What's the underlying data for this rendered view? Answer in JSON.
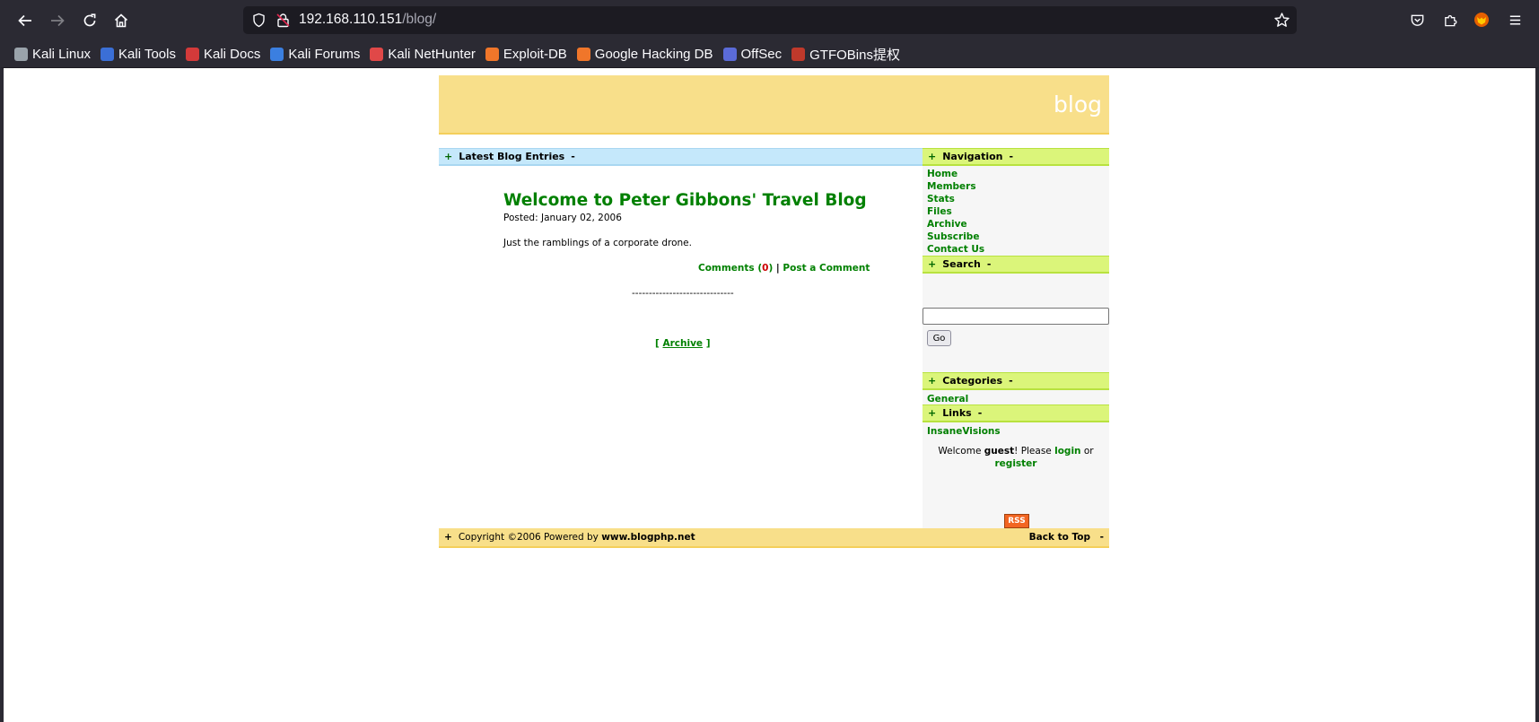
{
  "browser": {
    "url_host": "192.168.110.151",
    "url_path": "/blog/",
    "bookmarks": [
      {
        "label": "Kali Linux",
        "color": "#9aa3ab"
      },
      {
        "label": "Kali Tools",
        "color": "#3b6fd6"
      },
      {
        "label": "Kali Docs",
        "color": "#d33a3a"
      },
      {
        "label": "Kali Forums",
        "color": "#3b7fe0"
      },
      {
        "label": "Kali NetHunter",
        "color": "#e04848"
      },
      {
        "label": "Exploit-DB",
        "color": "#f0762a"
      },
      {
        "label": "Google Hacking DB",
        "color": "#f0762a"
      },
      {
        "label": "OffSec",
        "color": "#5b6bd8"
      },
      {
        "label": "GTFOBins提权",
        "color": "#c0392b"
      }
    ]
  },
  "site": {
    "title": "blog"
  },
  "main": {
    "section_label": "Latest Blog Entries",
    "plus": "+",
    "minus": "-",
    "post": {
      "title": "Welcome to Peter Gibbons' Travel Blog",
      "posted": "Posted: January 02, 2006",
      "body": "Just the ramblings of a corporate drone.",
      "comments_label": "Comments",
      "comments_open": " (",
      "comments_count": "0",
      "comments_close": ")",
      "divider": " | ",
      "post_comment_label": "Post a Comment"
    },
    "separator": "------------------------------",
    "archive_open": "[ ",
    "archive_label": "Archive",
    "archive_close": " ]"
  },
  "sidebar": {
    "navigation_label": "Navigation",
    "nav_items": [
      "Home",
      "Members",
      "Stats",
      "Files",
      "Archive",
      "Subscribe",
      "Contact Us"
    ],
    "search_label": "Search",
    "search_button": "Go",
    "categories_label": "Categories",
    "categories": [
      "General"
    ],
    "links_label": "Links",
    "links": [
      "InsaneVisions"
    ],
    "welcome": {
      "prefix": "Welcome ",
      "user": "guest",
      "middle": "! Please ",
      "login": "login",
      "or": " or",
      "register": "register"
    },
    "rss": "RSS"
  },
  "footer": {
    "copyright": "Copyright ©2006 Powered by ",
    "powered_site": "www.blogphp.net",
    "back_to_top": "Back to Top"
  }
}
